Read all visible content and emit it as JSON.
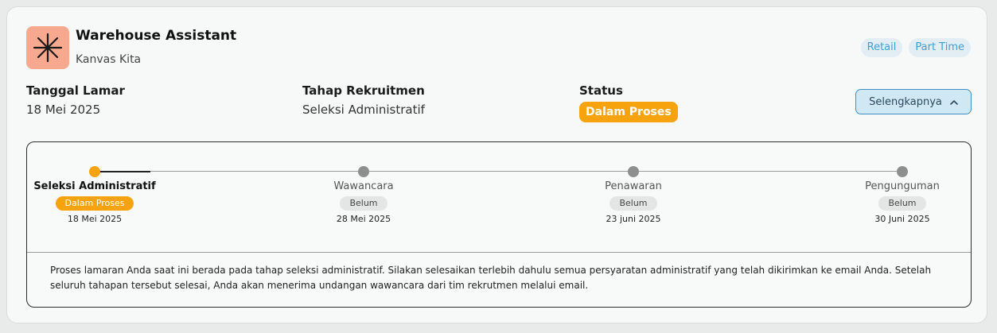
{
  "job": {
    "title": "Warehouse Assistant",
    "company": "Kanvas Kita",
    "logo_icon": "asterisk-logo-icon",
    "tags": [
      "Retail",
      "Part Time"
    ]
  },
  "info": {
    "applied_date_label": "Tanggal Lamar",
    "applied_date": "18 Mei 2025",
    "stage_label": "Tahap Rekruitmen",
    "stage": "Seleksi Administratif",
    "status_label": "Status",
    "status": "Dalam Proses"
  },
  "more_button": {
    "label": "Selengkapnya",
    "icon": "chevron-up-icon"
  },
  "timeline": {
    "progress_fraction": 0.07,
    "steps": [
      {
        "name": "Seleksi Administratif",
        "status": "Dalam Proses",
        "date": "18 Mei 2025",
        "active": true
      },
      {
        "name": "Wawancara",
        "status": "Belum",
        "date": "28 Mei 2025",
        "active": false
      },
      {
        "name": "Penawaran",
        "status": "Belum",
        "date": "23 juni 2025",
        "active": false
      },
      {
        "name": "Pengunguman",
        "status": "Belum",
        "date": "30 Juni 2025",
        "active": false
      }
    ],
    "description": "Proses lamaran Anda saat ini berada pada tahap seleksi administratif. Silakan selesaikan terlebih dahulu semua persyaratan administratif yang telah dikirimkan ke email Anda. Setelah seluruh tahapan tersebut selesai, Anda akan menerima undangan wawancara dari tim rekrutmen melalui email."
  },
  "colors": {
    "accent_orange": "#f7a30d",
    "tag_blue": "#3d9ed3",
    "logo_bg": "#f7a98f"
  }
}
